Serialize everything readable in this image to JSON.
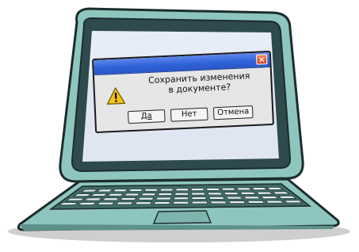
{
  "dialog": {
    "message_line1": "Сохранить изменения",
    "message_line2": "в документе?",
    "close_glyph": "×",
    "buttons": {
      "yes": "Да",
      "no": "Нет",
      "cancel": "Отмена"
    },
    "icon": "warning-icon"
  },
  "colors": {
    "laptop_body": "#8ec6bf",
    "screen_bezel": "#2f4a4d",
    "screen_bg": "#dfe6f2",
    "titlebar": "#2f62d8",
    "dialog_bg": "#e6e6e6",
    "warning_yellow": "#f5c518",
    "close_red": "#d9431c"
  }
}
